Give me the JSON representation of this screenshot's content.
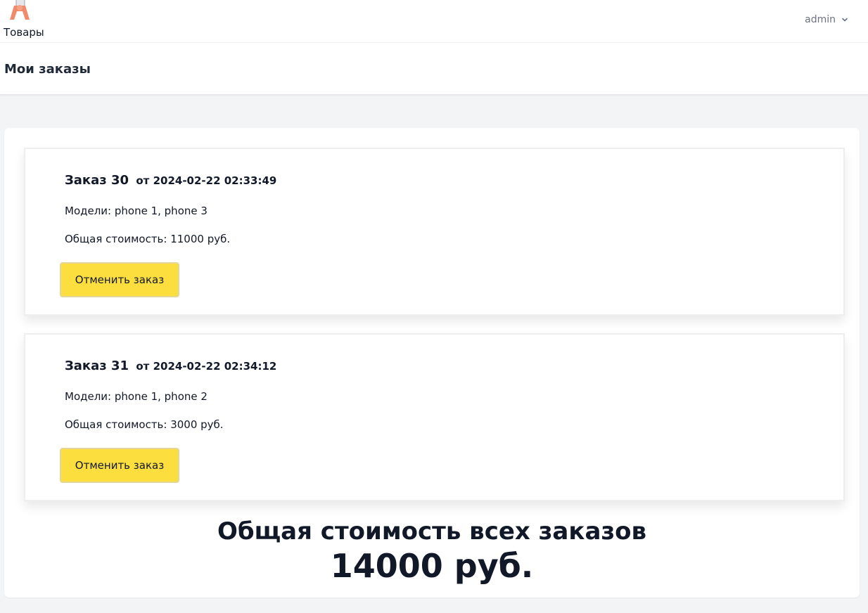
{
  "nav": {
    "products_label": "Товары",
    "user_label": "admin"
  },
  "header": {
    "title": "Мои заказы"
  },
  "orders": [
    {
      "title": "Заказ 30",
      "date": "от 2024-02-22 02:33:49",
      "models": "Модели: phone 1, phone 3",
      "total": "Общая стоимость: 11000 руб.",
      "cancel_label": "Отменить заказ"
    },
    {
      "title": "Заказ 31",
      "date": "от 2024-02-22 02:34:12",
      "models": "Модели: phone 1, phone 2",
      "total": "Общая стоимость: 3000 руб.",
      "cancel_label": "Отменить заказ"
    }
  ],
  "summary": {
    "label": "Общая стоимость всех заказов",
    "value": "14000 руб."
  },
  "icons": {
    "logo": "hand-holding-phone-icon",
    "user_menu": "chevron-down-icon"
  },
  "colors": {
    "button_bg": "#fcde3f",
    "page_bg": "#f3f4f6",
    "text": "#111827"
  }
}
